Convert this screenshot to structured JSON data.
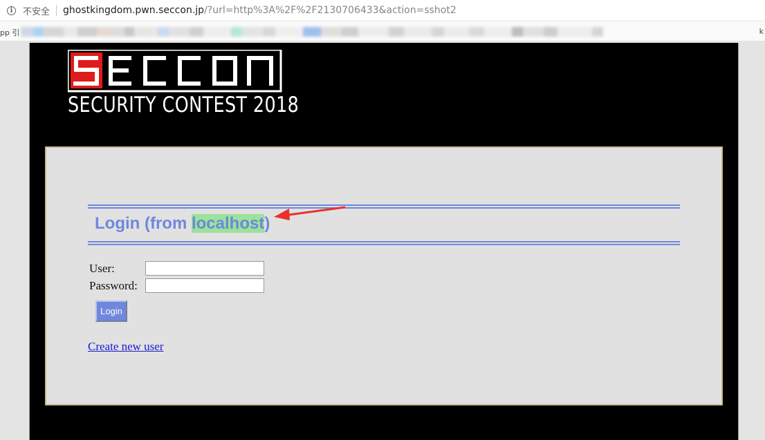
{
  "browser": {
    "security_label": "不安全",
    "url_host": "ghostkingdom.pwn.seccon.jp",
    "url_path": "/?url=http%3A%2F%2F2130706433&action=sshot2",
    "bookmarks_left": "pp 引",
    "bookmarks_right": "k"
  },
  "header": {
    "logo_text": "SECCON",
    "subtitle": "SECURITY CONTEST 2018"
  },
  "login": {
    "heading_prefix": "Login (from ",
    "heading_highlight": "localhost",
    "heading_suffix": ")",
    "user_label": "User:",
    "password_label": "Password:",
    "user_value": "",
    "password_value": "",
    "login_button": "Login",
    "create_link": "Create new user"
  },
  "colors": {
    "accent_blue": "#6f87dd",
    "highlight_green": "#9be29b",
    "box_border": "#c9b88f",
    "annotation_red": "#e8322b"
  }
}
